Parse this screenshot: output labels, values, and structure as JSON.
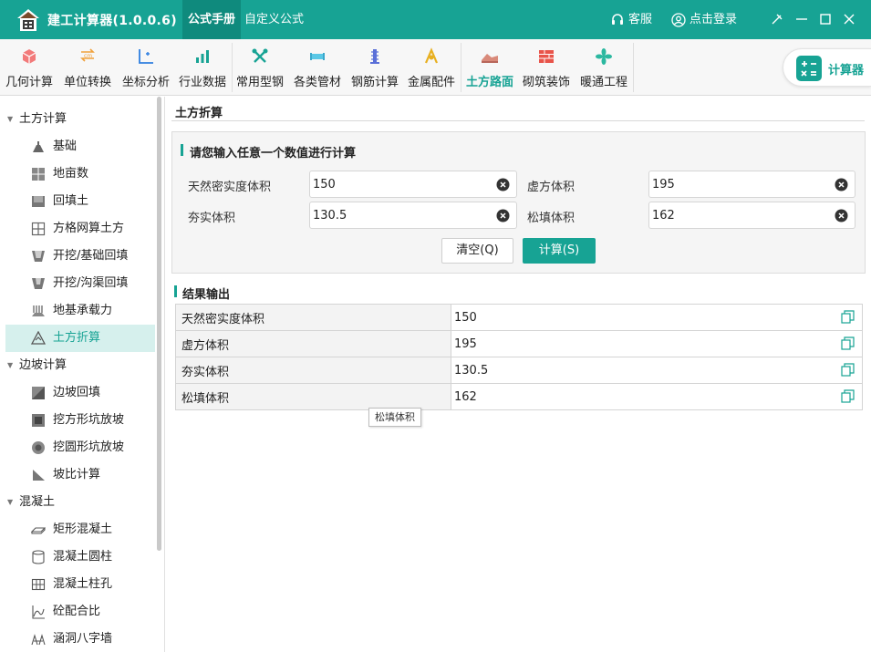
{
  "app": {
    "title": "建工计算器(1.0.0.6)"
  },
  "top_tabs": [
    {
      "label": "公式手册",
      "active": true
    },
    {
      "label": "自定义公式",
      "active": false
    }
  ],
  "top_right": {
    "service": "客服",
    "login": "点击登录"
  },
  "ribbon": {
    "items": [
      {
        "label": "几何计算",
        "icon": "cube-icon"
      },
      {
        "label": "单位转换",
        "icon": "unit-convert-icon"
      },
      {
        "label": "坐标分析",
        "icon": "coordinate-icon"
      },
      {
        "label": "行业数据",
        "icon": "bar-chart-icon"
      },
      {
        "label": "常用型钢",
        "icon": "tools-icon"
      },
      {
        "label": "各类管材",
        "icon": "pipe-icon"
      },
      {
        "label": "钢筋计算",
        "icon": "rebar-icon"
      },
      {
        "label": "金属配件",
        "icon": "metal-parts-icon"
      },
      {
        "label": "土方路面",
        "icon": "earthwork-icon",
        "active": true
      },
      {
        "label": "砌筑装饰",
        "icon": "brick-wall-icon"
      },
      {
        "label": "暖通工程",
        "icon": "fan-icon"
      }
    ],
    "calculator_label": "计算器"
  },
  "sidebar": {
    "groups": [
      {
        "label": "土方计算",
        "items": [
          {
            "label": "基础",
            "icon": "foundation-icon"
          },
          {
            "label": "地亩数",
            "icon": "land-area-icon"
          },
          {
            "label": "回填土",
            "icon": "backfill-icon"
          },
          {
            "label": "方格网算土方",
            "icon": "grid-icon"
          },
          {
            "label": "开挖/基础回填",
            "icon": "excavation-icon"
          },
          {
            "label": "开挖/沟渠回填",
            "icon": "trench-icon"
          },
          {
            "label": "地基承载力",
            "icon": "bearing-capacity-icon"
          },
          {
            "label": "土方折算",
            "icon": "earth-conversion-icon",
            "active": true
          }
        ]
      },
      {
        "label": "边坡计算",
        "items": [
          {
            "label": "边坡回填",
            "icon": "slope-backfill-icon"
          },
          {
            "label": "挖方形坑放坡",
            "icon": "square-pit-icon"
          },
          {
            "label": "挖圆形坑放坡",
            "icon": "round-pit-icon"
          },
          {
            "label": "坡比计算",
            "icon": "slope-ratio-icon"
          }
        ]
      },
      {
        "label": "混凝土",
        "items": [
          {
            "label": "矩形混凝土",
            "icon": "rect-concrete-icon"
          },
          {
            "label": "混凝土圆柱",
            "icon": "cylinder-icon"
          },
          {
            "label": "混凝土柱孔",
            "icon": "column-hole-icon"
          },
          {
            "label": "砼配合比",
            "icon": "mix-ratio-icon"
          },
          {
            "label": "涵洞八字墙",
            "icon": "culvert-icon"
          }
        ]
      }
    ]
  },
  "main": {
    "title": "土方折算",
    "input_section_title": "请您输入任意一个数值进行计算",
    "fields": [
      {
        "label": "天然密实度体积",
        "value": "150"
      },
      {
        "label": "虚方体积",
        "value": "195"
      },
      {
        "label": "夯实体积",
        "value": "130.5"
      },
      {
        "label": "松填体积",
        "value": "162"
      }
    ],
    "clear_button": "清空(Q)",
    "calc_button": "计算(S)",
    "result_section_title": "结果输出",
    "results": [
      {
        "label": "天然密实度体积",
        "value": "150"
      },
      {
        "label": "虚方体积",
        "value": "195"
      },
      {
        "label": "夯实体积",
        "value": "130.5"
      },
      {
        "label": "松填体积",
        "value": "162"
      }
    ],
    "tooltip": "松填体积"
  },
  "colors": {
    "accent": "#17a394",
    "accent_dark": "#0f8a7d",
    "selected_bg": "#d6f0ed"
  }
}
